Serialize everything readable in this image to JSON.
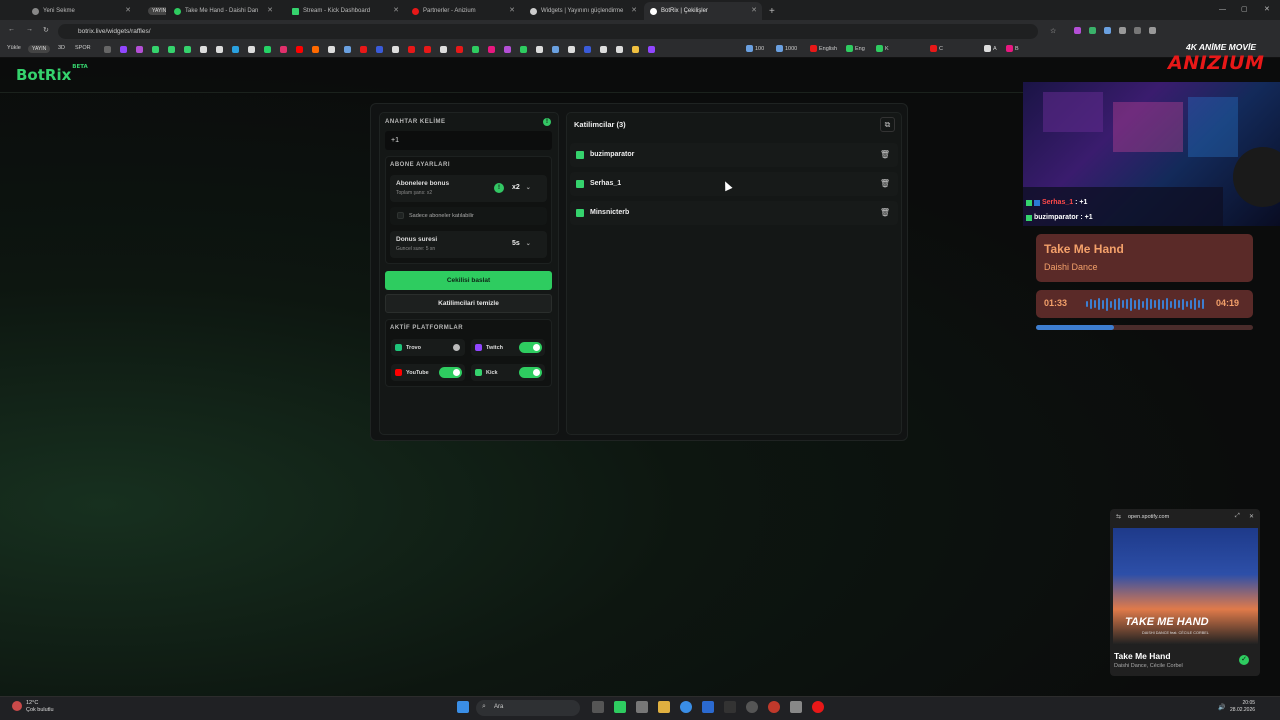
{
  "browser": {
    "tabs": [
      {
        "title": "Yeni Sekme",
        "color": "#888888"
      },
      {
        "title": "YAYIN",
        "color": "#555555"
      },
      {
        "title": "Take Me Hand - Daishi Dan",
        "color": "#2ecc60"
      },
      {
        "title": "Stream - Kick Dashboard",
        "color": "#35d36d"
      },
      {
        "title": "Partnerler - Anizium",
        "color": "#e81818"
      },
      {
        "title": "Widgets | Yayınını güçlendirme",
        "color": "#cccccc"
      },
      {
        "title": "BotRix | Çekilişler",
        "color": "#ffffff"
      }
    ],
    "url": "botrix.live/widgets/raffles/",
    "bookmarks": [
      "Yükle",
      "YAYIN",
      "3D",
      "SPOR",
      "100",
      "1000",
      "English",
      "Eng",
      "K",
      "C",
      "A",
      "B"
    ]
  },
  "app": {
    "logo": "BotRix",
    "logo_badge": "BETA"
  },
  "raffle": {
    "keyword_label": "ANAHTAR KELİME",
    "keyword_value": "+1",
    "subscriber_section": "ABONE AYARLARI",
    "sub_bonus_title": "Abonelere bonus",
    "sub_bonus_sub": "Toplam şans: x2",
    "sub_bonus_value": "x2",
    "subs_only_label": "Sadece aboneler katılabilir",
    "bonus_duration_title": "Donus suresi",
    "bonus_duration_sub": "Guncel sure: 5 sn",
    "bonus_duration_value": "5s",
    "start_button": "Cekilisi baslat",
    "clear_button": "Katilimcilari temizle",
    "platforms_label": "AKTİF PLATFORMLAR",
    "platforms": [
      {
        "name": "Trovo",
        "enabled": false,
        "color": "#1ec47a"
      },
      {
        "name": "Twitch",
        "enabled": true,
        "color": "#9146ff"
      },
      {
        "name": "YouTube",
        "enabled": true,
        "color": "#ff0000"
      },
      {
        "name": "Kick",
        "enabled": true,
        "color": "#35d36d"
      }
    ]
  },
  "participants": {
    "title": "Katilimcilar (3)",
    "list": [
      "buzimparator",
      "Serhas_1",
      "Minsnicterb"
    ]
  },
  "overlay": {
    "brand_tagline": "4K ANİME MOVİE",
    "brand_name": "ANIZIUM",
    "chat": [
      {
        "user": "Serhas_1",
        "text": ": +1",
        "user_color": "#ff4a4a"
      },
      {
        "user": "buzimparator",
        "text": ": +1",
        "user_color": "#ffffff"
      }
    ],
    "now_playing_title": "Take Me Hand",
    "now_playing_artist": "Daishi Dance",
    "time_current": "01:33",
    "time_total": "04:19",
    "progress_fraction": 0.36
  },
  "spotify": {
    "url": "open.spotify.com",
    "art_text": "TAKE ME HAND",
    "art_credit": "DAISHI DANCE feat. CÉCILE CORBEL",
    "title": "Take Me Hand",
    "artists": "Daishi Dance, Cécile Corbel"
  },
  "taskbar": {
    "temp": "12°C",
    "weather": "Çok bulutlu",
    "search_placeholder": "Ara",
    "time": "20:05",
    "date": "28.02.2026"
  }
}
